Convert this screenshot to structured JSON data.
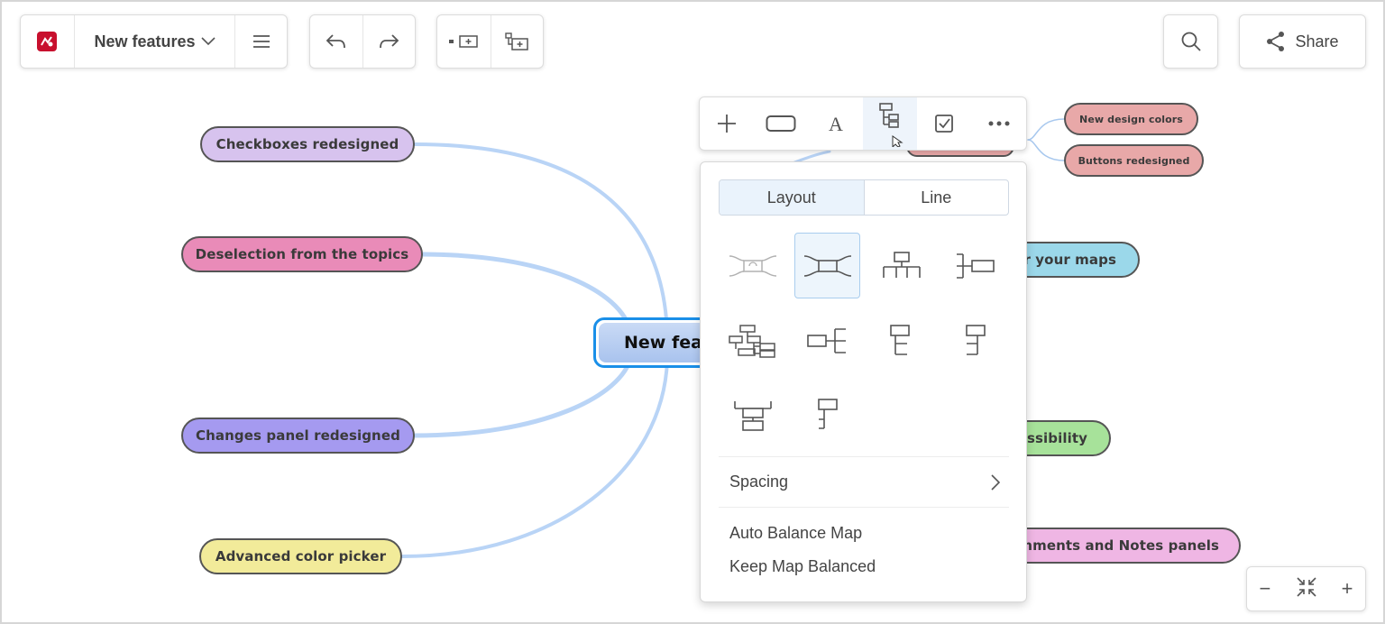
{
  "header": {
    "doc_title": "New features",
    "share_label": "Share"
  },
  "icons": {
    "app_logo": "mindmap-app-logo",
    "dropdown": "chevron-down-icon",
    "menu": "hamburger-menu-icon",
    "undo": "undo-icon",
    "redo": "redo-icon",
    "add_sibling": "add-topic-icon",
    "add_child": "add-subtopic-icon",
    "search": "search-icon",
    "share": "share-icon"
  },
  "central_topic": {
    "label": "New feat"
  },
  "left_topics": [
    {
      "label": "Checkboxes redesigned",
      "color": "#d7c3ee"
    },
    {
      "label": "Deselection from the topics",
      "color": "#e98bb8"
    },
    {
      "label": "Changes panel redesigned",
      "color": "#a59af0"
    },
    {
      "label": "Advanced color picker",
      "color": "#f2eb9a"
    }
  ],
  "right_topics": [
    {
      "label": "New design colors",
      "color": "#e8a8a8"
    },
    {
      "label": "Buttons redesigned",
      "color": "#e8a8a8"
    },
    {
      "label": "or your maps",
      "color": "#9bd8ea"
    },
    {
      "label": "essibility",
      "color": "#a7e29a"
    },
    {
      "label": "omments and Notes panels",
      "color": "#efb6e4"
    }
  ],
  "floating_toolbar": {
    "buttons": [
      "add-icon",
      "topic-shape-icon",
      "text-style-icon",
      "layout-icon",
      "checkbox-icon",
      "more-icon"
    ],
    "active": "layout-icon"
  },
  "layout_panel": {
    "tabs": [
      "Layout",
      "Line"
    ],
    "active_tab": "Layout",
    "spacing_label": "Spacing",
    "auto_balance_label": "Auto Balance Map",
    "keep_balanced_label": "Keep Map Balanced"
  },
  "zoom": {
    "zoom_out": "−",
    "zoom_in": "+"
  },
  "colors": {
    "accent": "#1a8fe8",
    "branch_line": "#b7d3f5"
  }
}
